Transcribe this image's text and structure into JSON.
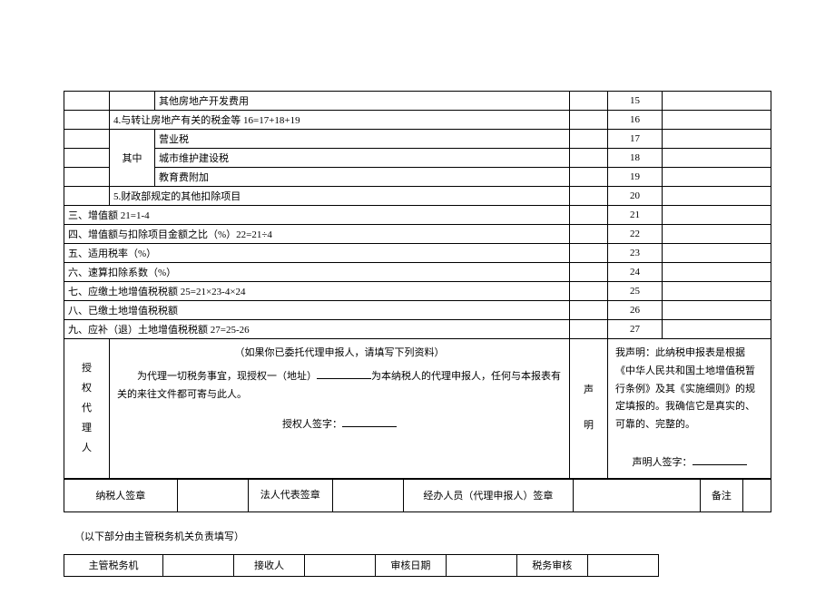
{
  "rows": {
    "r15": {
      "label": "其他房地产开发费用",
      "num": "15"
    },
    "r16": {
      "label": "4.与转让房地产有关的税金等 16=17+18+19",
      "num": "16"
    },
    "r_qz": "其中",
    "r17": {
      "label": "营业税",
      "num": "17"
    },
    "r18": {
      "label": "城市维护建设税",
      "num": "18"
    },
    "r19": {
      "label": "教育费附加",
      "num": "19"
    },
    "r20": {
      "label": "5.财政部规定的其他扣除项目",
      "num": "20"
    },
    "r21": {
      "label": "三、增值额 21=1-4",
      "num": "21"
    },
    "r22": {
      "label": "四、增值额与扣除项目金额之比（%）22=21÷4",
      "num": "22"
    },
    "r23": {
      "label": "五、适用税率（%）",
      "num": "23"
    },
    "r24": {
      "label": "六、速算扣除系数（%）",
      "num": "24"
    },
    "r25": {
      "label": "七、应缴土地增值税税额 25=21×23-4×24",
      "num": "25"
    },
    "r26": {
      "label": "八、已缴土地增值税税额",
      "num": "26"
    },
    "r27": {
      "label": "九、应补（退）土地增值税税额 27=25-26",
      "num": "27"
    }
  },
  "auth": {
    "title": "授权代理人",
    "line1": "（如果你已委托代理申报人，请填写下列资料）",
    "line2a": "为代理一切税务事宜，现授权一（地址）",
    "line2b": "为本纳税人的代理申报人，任何与本报表有关的来往文件都可寄与此人。",
    "sign_label": "授权人签字："
  },
  "decl": {
    "title_a": "声",
    "title_b": "明",
    "body": "我声明：此纳税申报表是根据《中华人民共和国土地增值税暂行条例》及其《实施细则》的规定填报的。我确信它是真实的、可靠的、完整的。",
    "sign_label": "声明人签字："
  },
  "sig": {
    "taxpayer": "纳税人签章",
    "legal": "法人代表签章",
    "agent": "经办人员（代理申报人）签章",
    "remark": "备注"
  },
  "note": "（以下部分由主管税务机关负责填写）",
  "bottom": {
    "c1": "主管税务机",
    "c2": "接收人",
    "c3": "审核日期",
    "c4": "税务审核"
  }
}
